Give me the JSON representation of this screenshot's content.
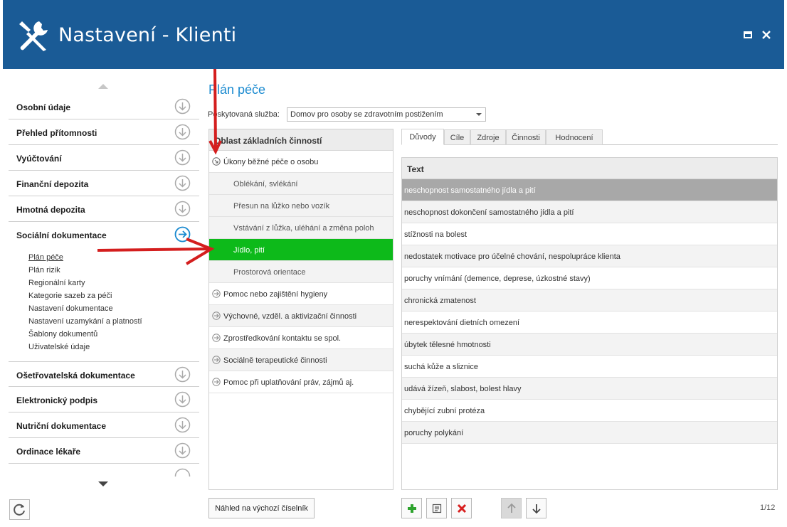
{
  "window": {
    "title": "Nastavení - Klienti",
    "icon": "tools-icon",
    "controls": [
      "maximize-icon",
      "close-icon"
    ]
  },
  "sidebar": {
    "items_top": [
      {
        "label": "Osobní údaje",
        "icon": "circle-arrow-down-icon"
      },
      {
        "label": "Přehled přítomnosti",
        "icon": "circle-arrow-down-icon"
      },
      {
        "label": "Vyúčtování",
        "icon": "circle-arrow-down-icon"
      },
      {
        "label": "Finanční depozita",
        "icon": "circle-arrow-down-icon"
      },
      {
        "label": "Hmotná depozita",
        "icon": "circle-arrow-down-icon"
      },
      {
        "label": "Sociální dokumentace",
        "icon": "circle-arrow-right-icon",
        "expanded": true
      }
    ],
    "subitems": [
      {
        "label": "Plán péče",
        "active": true
      },
      {
        "label": "Plán rizik"
      },
      {
        "label": "Regionální karty"
      },
      {
        "label": "Kategorie sazeb za péči"
      },
      {
        "label": "Nastavení dokumentace"
      },
      {
        "label": "Nastavení uzamykání a platností"
      },
      {
        "label": "Šablony dokumentů"
      },
      {
        "label": "Uživatelské údaje"
      }
    ],
    "items_bottom": [
      {
        "label": "Ošetřovatelská dokumentace",
        "icon": "circle-arrow-down-icon"
      },
      {
        "label": "Elektronický podpis",
        "icon": "circle-arrow-down-icon"
      },
      {
        "label": "Nutriční dokumentace",
        "icon": "circle-arrow-down-icon"
      },
      {
        "label": "Ordinace lékaře",
        "icon": "circle-arrow-down-icon"
      }
    ],
    "refresh_icon": "refresh-icon"
  },
  "main": {
    "heading": "Plán péče",
    "service_label": "Poskytovaná služba:",
    "service_value": "Domov pro osoby se zdravotním postižením",
    "areas": {
      "header": "Oblast základních činností",
      "rows": [
        {
          "label": "Úkony běžné péče o osobu",
          "level": 0,
          "icon": "circle-arrow-collapse-icon"
        },
        {
          "label": "Oblékání, svlékání",
          "level": 1
        },
        {
          "label": "Přesun na lůžko nebo vozík",
          "level": 1
        },
        {
          "label": "Vstávání z lůžka, uléhání a změna poloh",
          "level": 1
        },
        {
          "label": "Jídlo, pití",
          "level": 1,
          "selected": true
        },
        {
          "label": "Prostorová orientace",
          "level": 1
        },
        {
          "label": "Pomoc nebo zajištění hygieny",
          "level": 0,
          "icon": "circle-arrow-right-icon"
        },
        {
          "label": "Výchovné, vzděl. a aktivizační činnosti",
          "level": 0,
          "icon": "circle-arrow-right-icon"
        },
        {
          "label": "Zprostředkování kontaktu se spol.",
          "level": 0,
          "icon": "circle-arrow-right-icon"
        },
        {
          "label": "Sociálně terapeutické činnosti",
          "level": 0,
          "icon": "circle-arrow-right-icon"
        },
        {
          "label": "Pomoc při uplatňování práv, zájmů aj.",
          "level": 0,
          "icon": "circle-arrow-right-icon"
        }
      ]
    },
    "tabs": [
      {
        "label": "Důvody",
        "active": true
      },
      {
        "label": "Cíle"
      },
      {
        "label": "Zdroje"
      },
      {
        "label": "Činnosti"
      },
      {
        "label": "Hodnocení"
      }
    ],
    "grid": {
      "column": "Text",
      "rows": [
        {
          "text": "neschopnost samostatného jídla a pití",
          "selected": true
        },
        {
          "text": "neschopnost dokončení samostatného jídla a pití"
        },
        {
          "text": "stížnosti na bolest"
        },
        {
          "text": "nedostatek motivace pro účelné chování, nespolupráce klienta"
        },
        {
          "text": "poruchy vnímání (demence, deprese, úzkostné stavy)"
        },
        {
          "text": "chronická zmatenost"
        },
        {
          "text": "nerespektování dietních omezení"
        },
        {
          "text": "úbytek tělesné hmotnosti"
        },
        {
          "text": "suchá kůže a sliznice"
        },
        {
          "text": "udává žízeň, slabost, bolest hlavy"
        },
        {
          "text": "chybějící zubní protéza"
        },
        {
          "text": "poruchy polykání"
        }
      ]
    },
    "buttons": {
      "preview": "Náhled na výchozí číselník",
      "add_icon": "plus-icon",
      "edit_icon": "edit-icon",
      "delete_icon": "delete-icon",
      "up_icon": "arrow-up-icon",
      "down_icon": "arrow-down-icon"
    },
    "pager": "1/12"
  },
  "colors": {
    "titlebar": "#1a5b96",
    "heading": "#1a8ad0",
    "selected_area": "#0dba1a",
    "selected_grid_row": "#a8a8a8",
    "annotation_arrow": "#d41e1e"
  }
}
